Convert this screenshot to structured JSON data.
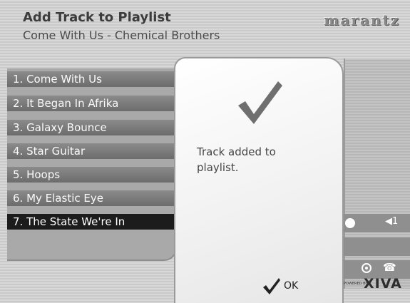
{
  "header": {
    "title": "Add Track to Playlist",
    "subtitle": "Come With Us - Chemical Brothers",
    "brand": "marantz"
  },
  "tracks": [
    {
      "label": "1. Come With Us",
      "selected": false
    },
    {
      "label": "2. It Began In Afrika",
      "selected": false
    },
    {
      "label": "3. Galaxy Bounce",
      "selected": false
    },
    {
      "label": "4. Star Guitar",
      "selected": false
    },
    {
      "label": "5. Hoops",
      "selected": false
    },
    {
      "label": "6. My Elastic Eye",
      "selected": false
    },
    {
      "label": "7. The State We're In",
      "selected": true
    }
  ],
  "dialog": {
    "message": "Track added to playlist.",
    "ok_label": "OK",
    "icon": "checkmark-icon"
  },
  "controls": {
    "volume_label": "◀1",
    "powered_by": "POWERED BY",
    "xiva_logo": "XIVA",
    "icons": [
      "status-dot-icon",
      "speaker-icon",
      "disc-icon",
      "phone-icon"
    ]
  }
}
